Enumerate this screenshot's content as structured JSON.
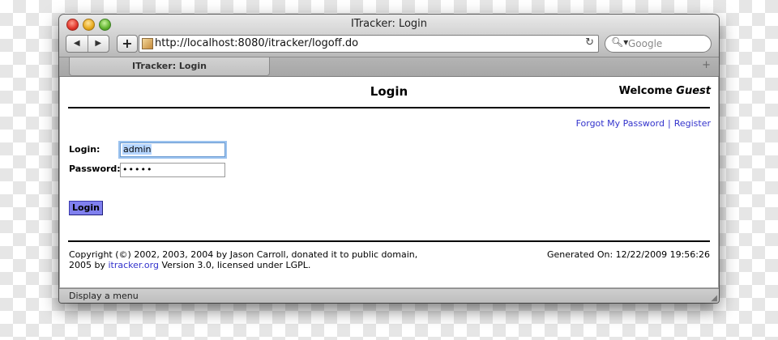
{
  "window": {
    "title": "ITracker: Login"
  },
  "toolbar": {
    "back_icon": "back-arrow",
    "forward_icon": "forward-arrow",
    "add_label": "+",
    "url": "http://localhost:8080/itracker/logoff.do",
    "reload_icon": "reload",
    "search_placeholder": "Google"
  },
  "tabs": [
    {
      "label": "ITracker: Login"
    }
  ],
  "page": {
    "title": "Login",
    "welcome_prefix": "Welcome",
    "welcome_user": "Guest",
    "links": {
      "forgot": "Forgot My Password",
      "separator": "|",
      "register": "Register"
    },
    "form": {
      "login_label": "Login:",
      "login_value": "admin",
      "password_label": "Password:",
      "password_value": "•••••",
      "submit_label": "Login"
    },
    "footer": {
      "copyright_line1": "Copyright (©) 2002, 2003, 2004 by Jason Carroll, donated it to public domain,",
      "copyright_line2_prefix": "2005 by ",
      "copyright_link": "itracker.org",
      "copyright_line2_suffix": " Version 3.0, licensed under LGPL.",
      "generated": "Generated On: 12/22/2009 19:56:26"
    }
  },
  "statusbar": {
    "text": "Display a menu"
  },
  "colors": {
    "link": "#3333cc",
    "button": "#8080ee"
  }
}
